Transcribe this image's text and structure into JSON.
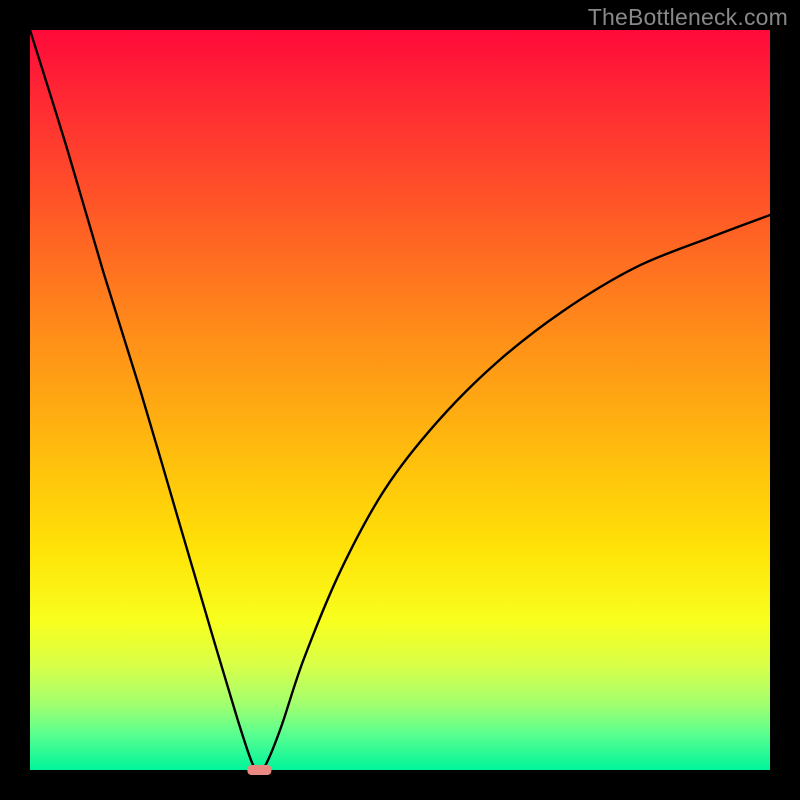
{
  "watermark": "TheBottleneck.com",
  "chart_data": {
    "type": "line",
    "title": "",
    "xlabel": "",
    "ylabel": "",
    "xlim": [
      0,
      100
    ],
    "ylim": [
      0,
      100
    ],
    "grid": false,
    "legend": false,
    "background_gradient": {
      "top": "#ff0a3a",
      "middle_upper": "#ff8a1a",
      "middle_lower": "#ffe207",
      "bottom": "#00f59b",
      "meaning": "red high bottleneck to green low bottleneck"
    },
    "series": [
      {
        "name": "bottleneck-curve",
        "x": [
          0,
          5,
          10,
          15,
          20,
          25,
          28,
          30,
          31,
          32,
          34,
          37,
          42,
          48,
          55,
          63,
          72,
          82,
          92,
          100
        ],
        "values": [
          100,
          84,
          67,
          51,
          34,
          17,
          7,
          1,
          0,
          1,
          6,
          15,
          27,
          38,
          47,
          55,
          62,
          68,
          72,
          75
        ]
      }
    ],
    "minimum_point": {
      "x": 31,
      "y": 0
    },
    "minimum_marker_color": "#e98a82"
  }
}
